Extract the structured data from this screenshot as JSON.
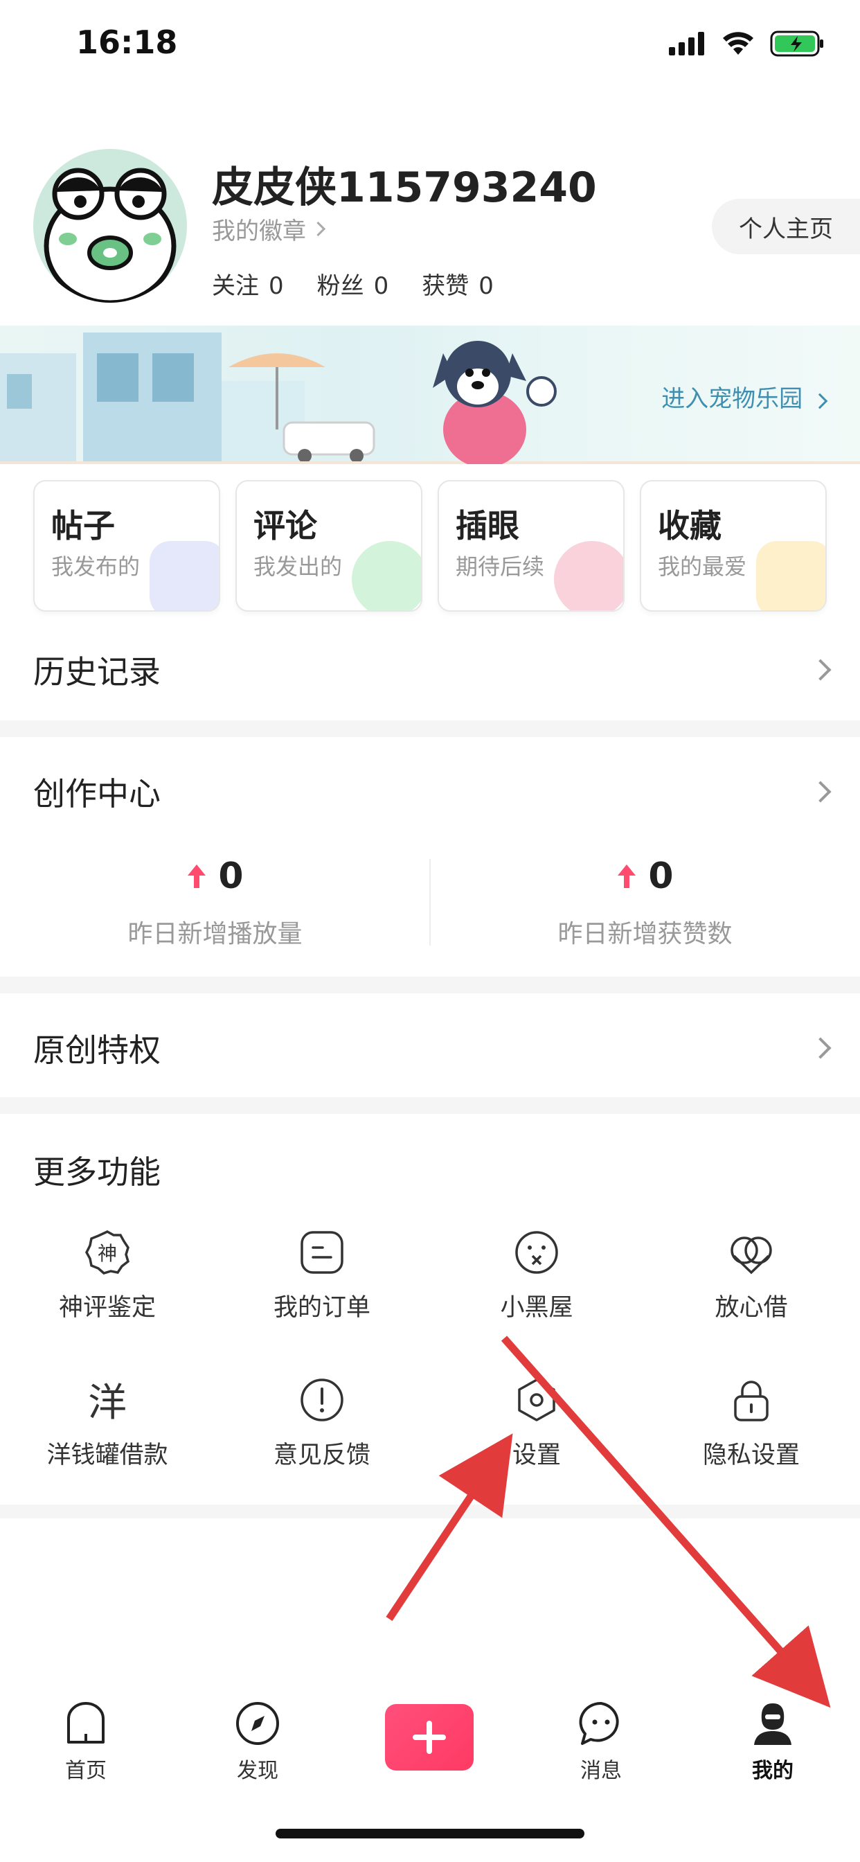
{
  "status_bar": {
    "time": "16:18"
  },
  "profile": {
    "username": "皮皮侠115793240",
    "badge_link": "我的徽章",
    "homepage_button": "个人主页",
    "stats": [
      {
        "label": "关注",
        "value": "0"
      },
      {
        "label": "粉丝",
        "value": "0"
      },
      {
        "label": "获赞",
        "value": "0"
      }
    ]
  },
  "banner": {
    "link": "进入宠物乐园"
  },
  "quick_cards": [
    {
      "title": "帖子",
      "sub": "我发布的",
      "accent": "#c9d2f5"
    },
    {
      "title": "评论",
      "sub": "我发出的",
      "accent": "#a8e7b5"
    },
    {
      "title": "插眼",
      "sub": "期待后续",
      "accent": "#f6a6b8"
    },
    {
      "title": "收藏",
      "sub": "我的最爱",
      "accent": "#ffe29a"
    }
  ],
  "history": {
    "title": "历史记录"
  },
  "creation": {
    "title": "创作中心",
    "metrics": [
      {
        "value": "0",
        "label": "昨日新增播放量"
      },
      {
        "value": "0",
        "label": "昨日新增获赞数"
      }
    ]
  },
  "original": {
    "title": "原创特权"
  },
  "more": {
    "title": "更多功能",
    "items": [
      {
        "label": "神评鉴定",
        "icon": "shen-badge-icon"
      },
      {
        "label": "我的订单",
        "icon": "order-icon"
      },
      {
        "label": "小黑屋",
        "icon": "blocked-face-icon"
      },
      {
        "label": "放心借",
        "icon": "loan-icon"
      },
      {
        "label": "洋钱罐借款",
        "icon": "yang-icon"
      },
      {
        "label": "意见反馈",
        "icon": "feedback-icon"
      },
      {
        "label": "设置",
        "icon": "settings-icon"
      },
      {
        "label": "隐私设置",
        "icon": "lock-icon"
      }
    ]
  },
  "tab_bar": {
    "items": [
      {
        "label": "首页",
        "icon": "home-icon"
      },
      {
        "label": "发现",
        "icon": "compass-icon"
      },
      {
        "label": "",
        "icon": "plus-icon"
      },
      {
        "label": "消息",
        "icon": "message-icon"
      },
      {
        "label": "我的",
        "icon": "profile-icon",
        "active": true
      }
    ]
  },
  "colors": {
    "accent": "#ff3a63",
    "annotation_arrow": "#e23b3b"
  }
}
